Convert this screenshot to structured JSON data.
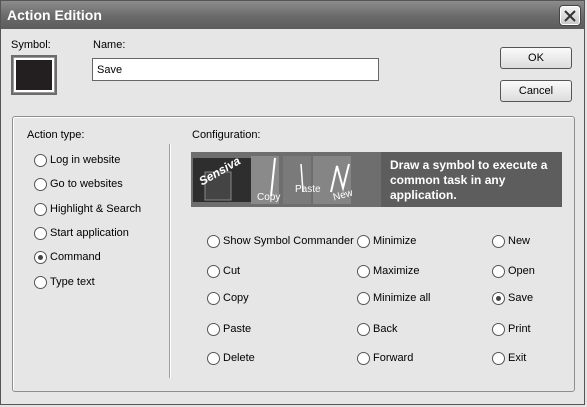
{
  "window": {
    "title": "Action Edition"
  },
  "symbol": {
    "label": "Symbol:"
  },
  "name": {
    "label": "Name:",
    "value": "Save"
  },
  "buttons": {
    "ok": "OK",
    "cancel": "Cancel"
  },
  "action_type": {
    "label": "Action type:",
    "options": [
      "Log in website",
      "Go to websites",
      "Highlight & Search",
      "Start application",
      "Command",
      "Type text"
    ],
    "selected": "Command"
  },
  "configuration": {
    "label": "Configuration:",
    "banner": {
      "text": "Draw a symbol to execute a common task in any application.",
      "logo": "Sensiva",
      "thumb_copy": "Copy",
      "thumb_paste": "Paste",
      "thumb_new": "New"
    },
    "col1": [
      "Show Symbol Commander",
      "Cut",
      "Copy",
      "Paste",
      "Delete"
    ],
    "col2": [
      "Minimize",
      "Maximize",
      "Minimize all",
      "Back",
      "Forward"
    ],
    "col3": [
      "New",
      "Open",
      "Save",
      "Print",
      "Exit"
    ],
    "selected": "Save"
  }
}
